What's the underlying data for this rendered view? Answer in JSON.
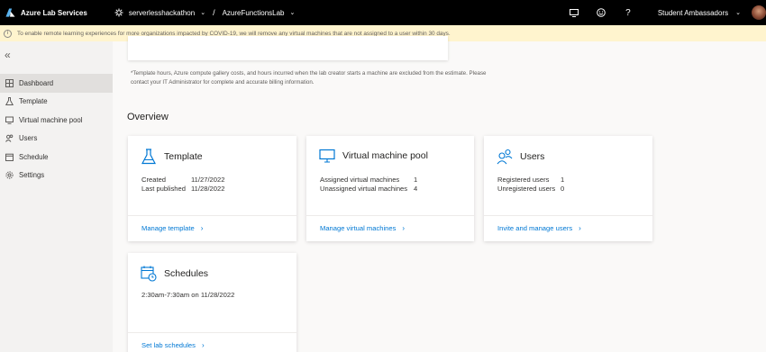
{
  "header": {
    "app_name": "Azure Lab Services",
    "lab_plan": "serverlesshackathon",
    "separator": "/",
    "lab_name": "AzureFunctionsLab",
    "user_name": "Student Ambassadors",
    "icons": [
      "monitor-icon",
      "smiley-icon",
      "help-icon"
    ]
  },
  "banner": {
    "text": "To enable remote learning experiences for more organizations impacted by COVID-19, we will remove any virtual machines that are not assigned to a user within 30 days."
  },
  "sidebar": {
    "collapse_icon": "double-chevron-left-icon",
    "items": [
      {
        "label": "Dashboard",
        "icon": "dashboard-icon",
        "active": true
      },
      {
        "label": "Template",
        "icon": "flask-icon",
        "active": false
      },
      {
        "label": "Virtual machine pool",
        "icon": "monitor-icon",
        "active": false
      },
      {
        "label": "Users",
        "icon": "users-icon",
        "active": false
      },
      {
        "label": "Schedule",
        "icon": "calendar-icon",
        "active": false
      },
      {
        "label": "Settings",
        "icon": "gear-icon",
        "active": false
      }
    ]
  },
  "main": {
    "cost_note": "*Template hours, Azure compute gallery costs, and hours incurred when the lab creator starts a machine are excluded from the estimate. Please contact your IT Administrator for complete and accurate billing information.",
    "overview_title": "Overview",
    "cards": {
      "template": {
        "title": "Template",
        "rows": [
          {
            "label": "Created",
            "value": "11/27/2022"
          },
          {
            "label": "Last published",
            "value": "11/28/2022"
          }
        ],
        "link": "Manage template"
      },
      "vm_pool": {
        "title": "Virtual machine pool",
        "rows": [
          {
            "label": "Assigned virtual machines",
            "value": "1"
          },
          {
            "label": "Unassigned virtual machines",
            "value": "4"
          }
        ],
        "link": "Manage virtual machines"
      },
      "users": {
        "title": "Users",
        "rows": [
          {
            "label": "Registered users",
            "value": "1"
          },
          {
            "label": "Unregistered users",
            "value": "0"
          }
        ],
        "link": "Invite and manage users"
      },
      "schedules": {
        "title": "Schedules",
        "text": "2:30am-7:30am on 11/28/2022",
        "link": "Set lab schedules"
      }
    }
  },
  "colors": {
    "accent": "#0078d4",
    "topbar": "#000000",
    "banner": "#fff4ce",
    "sidebar": "#f3f2f1"
  }
}
